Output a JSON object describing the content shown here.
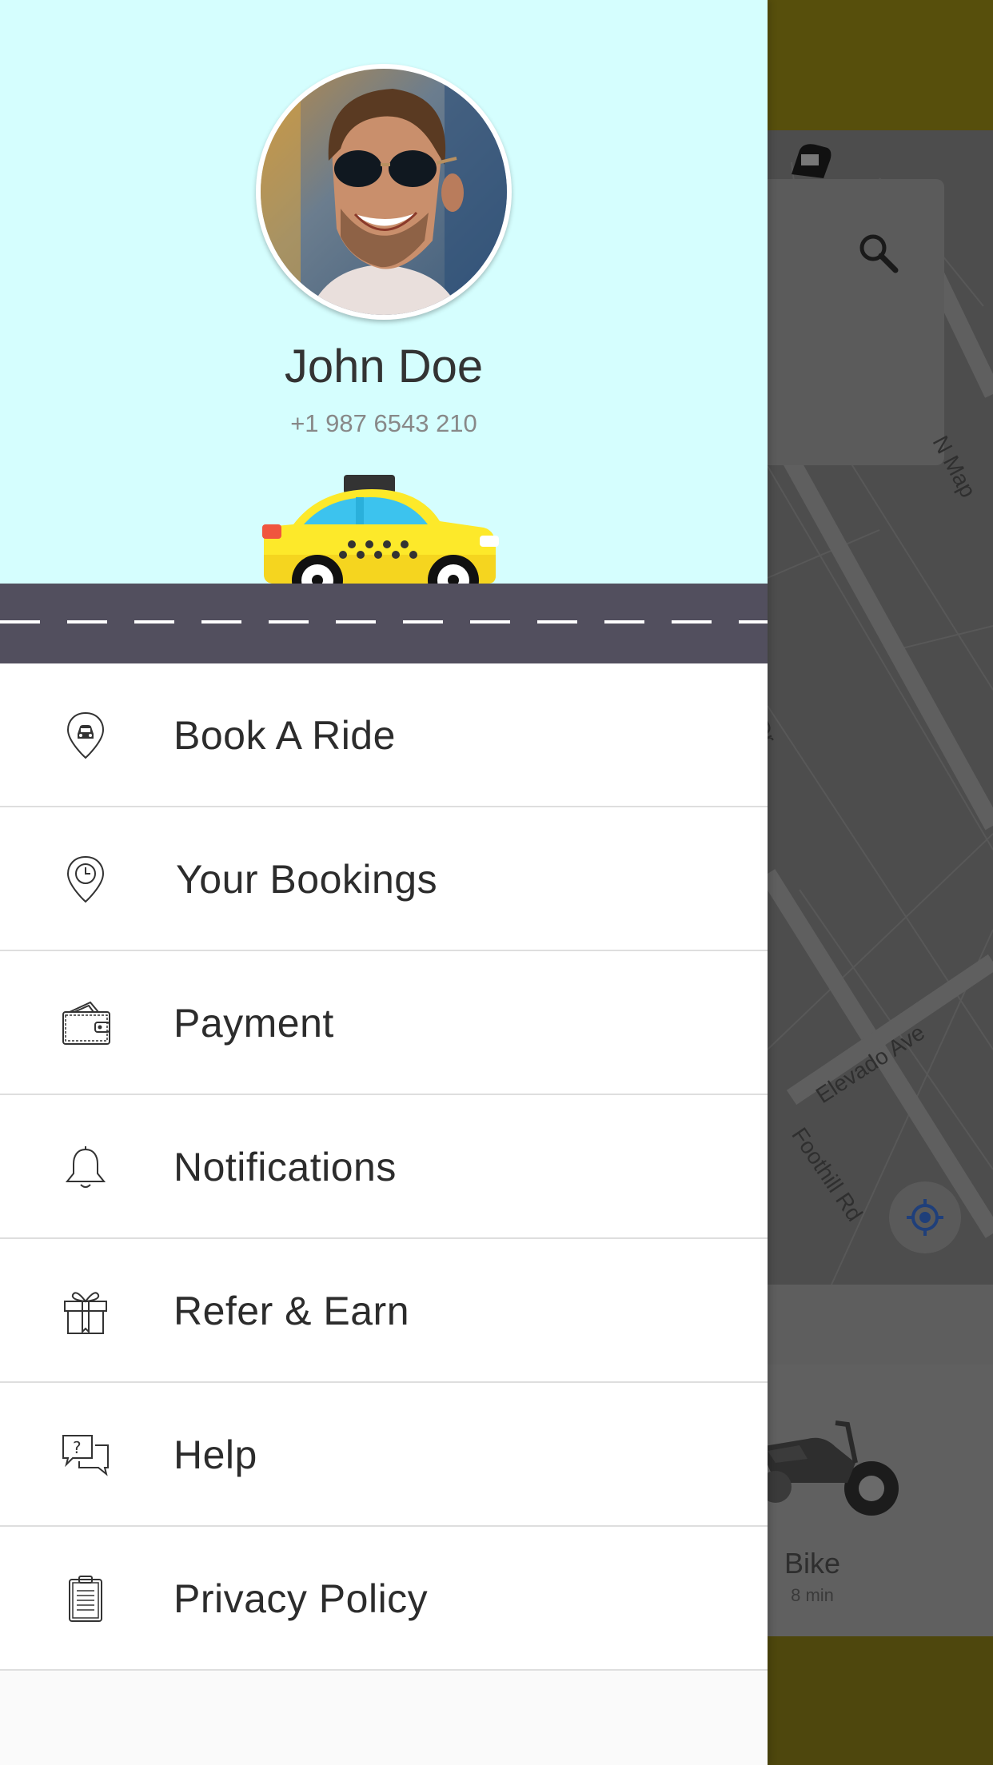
{
  "user": {
    "name": "John Doe",
    "phone": "+1 987 6543 210"
  },
  "menu": {
    "items": [
      {
        "label": "Book A Ride",
        "icon": "car-pin-icon"
      },
      {
        "label": "Your Bookings",
        "icon": "clock-pin-icon"
      },
      {
        "label": "Payment",
        "icon": "wallet-icon"
      },
      {
        "label": "Notifications",
        "icon": "bell-icon"
      },
      {
        "label": "Refer & Earn",
        "icon": "gift-icon"
      },
      {
        "label": "Help",
        "icon": "help-chat-icon"
      },
      {
        "label": "Privacy Policy",
        "icon": "clipboard-icon"
      }
    ]
  },
  "background": {
    "streets": [
      "N Map",
      "Dr",
      "Elevado Ave",
      "Foothill Rd"
    ],
    "vehicle": {
      "label": "Bike",
      "time": "8 min"
    }
  },
  "colors": {
    "header_bg": "#d5fefe",
    "road": "#524f5e",
    "taxi_yellow": "#fde92a",
    "overlay_yellow": "#574f0c"
  }
}
